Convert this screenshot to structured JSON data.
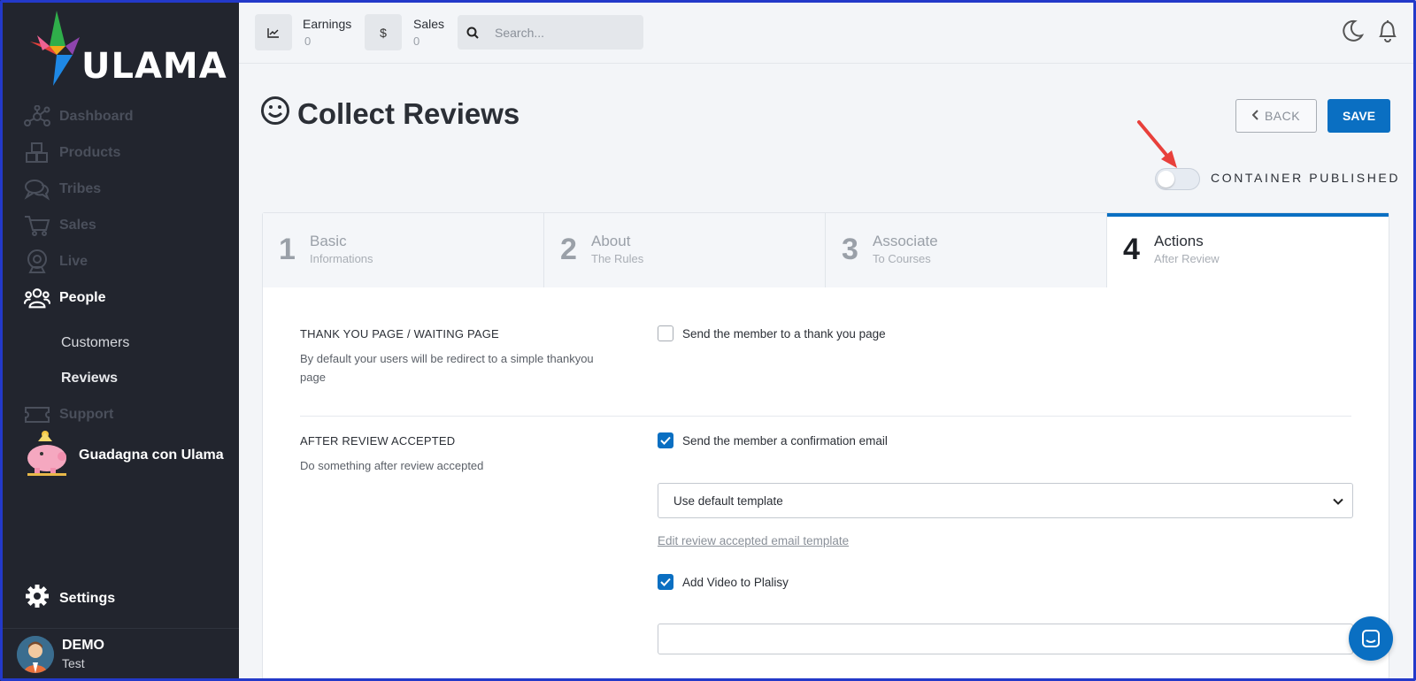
{
  "brand": {
    "name": "ULAMA"
  },
  "sidebar": {
    "items": [
      {
        "label": "Dashboard",
        "icon": "hub-icon"
      },
      {
        "label": "Products",
        "icon": "boxes-icon"
      },
      {
        "label": "Tribes",
        "icon": "chat-bubbles-icon"
      },
      {
        "label": "Sales",
        "icon": "cart-icon"
      },
      {
        "label": "Live",
        "icon": "webcam-icon"
      },
      {
        "label": "People",
        "icon": "users-icon"
      }
    ],
    "sub_items": [
      {
        "label": "Customers"
      },
      {
        "label": "Reviews"
      }
    ],
    "support": {
      "label": "Support",
      "icon": "ticket-icon"
    },
    "promo": {
      "label": "Guadagna con Ulama",
      "icon": "piggy-bank-icon"
    },
    "settings": {
      "label": "Settings",
      "icon": "gear-icon"
    },
    "user": {
      "name": "DEMO",
      "subtitle": "Test"
    }
  },
  "topbar": {
    "earnings": {
      "label": "Earnings",
      "value": "0"
    },
    "sales": {
      "label": "Sales",
      "value": "0"
    },
    "search": {
      "placeholder": "Search..."
    }
  },
  "page": {
    "title": "Collect Reviews",
    "back_label": "BACK",
    "save_label": "SAVE",
    "toggle": {
      "label": "CONTAINER PUBLISHED",
      "on": false
    }
  },
  "steps": [
    {
      "num": "1",
      "title": "Basic",
      "subtitle": "Informations",
      "active": false
    },
    {
      "num": "2",
      "title": "About",
      "subtitle": "The Rules",
      "active": false
    },
    {
      "num": "3",
      "title": "Associate",
      "subtitle": "To Courses",
      "active": false
    },
    {
      "num": "4",
      "title": "Actions",
      "subtitle": "After Review",
      "active": true
    }
  ],
  "sections": {
    "thank_you": {
      "title": "THANK YOU PAGE / WAITING PAGE",
      "desc_line1": "By default your users will be redirect to a simple thankyou",
      "desc_line2": "page",
      "checkbox_label": "Send the member to a thank you page",
      "checked": false
    },
    "after_review": {
      "title": "AFTER REVIEW ACCEPTED",
      "desc": "Do something after review accepted",
      "email_checkbox_label": "Send the member a confirmation email",
      "email_checked": true,
      "template_select": "Use default template",
      "edit_link": "Edit review accepted email template",
      "video_checkbox_label": "Add Video to Plalisy",
      "video_checked": true,
      "video_input": ""
    }
  },
  "colors": {
    "primary": "#0a6fc2",
    "sidebar_bg": "#22252e",
    "annotation_arrow": "#e8403b"
  }
}
